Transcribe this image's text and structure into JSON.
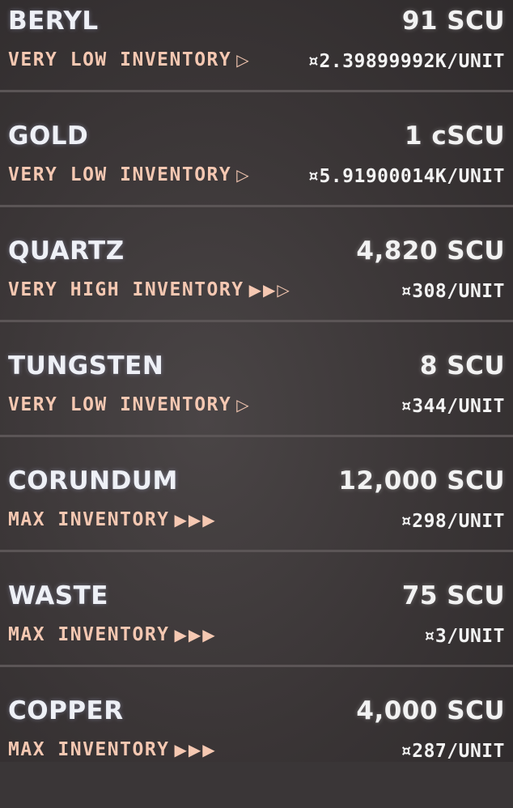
{
  "commodities": [
    {
      "name": "BERYL",
      "quantity": "91 SCU",
      "status": "VERY LOW INVENTORY",
      "arrows": "▷",
      "price": "¤2.39899992K/UNIT"
    },
    {
      "name": "GOLD",
      "quantity": "1 cSCU",
      "status": "VERY LOW INVENTORY",
      "arrows": "▷",
      "price": "¤5.91900014K/UNIT"
    },
    {
      "name": "QUARTZ",
      "quantity": "4,820 SCU",
      "status": "VERY HIGH INVENTORY",
      "arrows": "▶▶▷",
      "price": "¤308/UNIT"
    },
    {
      "name": "TUNGSTEN",
      "quantity": "8 SCU",
      "status": "VERY LOW INVENTORY",
      "arrows": "▷",
      "price": "¤344/UNIT"
    },
    {
      "name": "CORUNDUM",
      "quantity": "12,000 SCU",
      "status": "MAX INVENTORY",
      "arrows": "▶▶▶",
      "price": "¤298/UNIT"
    },
    {
      "name": "WASTE",
      "quantity": "75 SCU",
      "status": "MAX INVENTORY",
      "arrows": "▶▶▶",
      "price": "¤3/UNIT"
    },
    {
      "name": "COPPER",
      "quantity": "4,000 SCU",
      "status": "MAX INVENTORY",
      "arrows": "▶▶▶",
      "price": "¤287/UNIT"
    }
  ],
  "colors": {
    "background": "#3a3637",
    "name_text": "#eef0f6",
    "status_text": "#f5c8b2",
    "value_text": "#f2f2f2",
    "separator": "#5b5556"
  }
}
